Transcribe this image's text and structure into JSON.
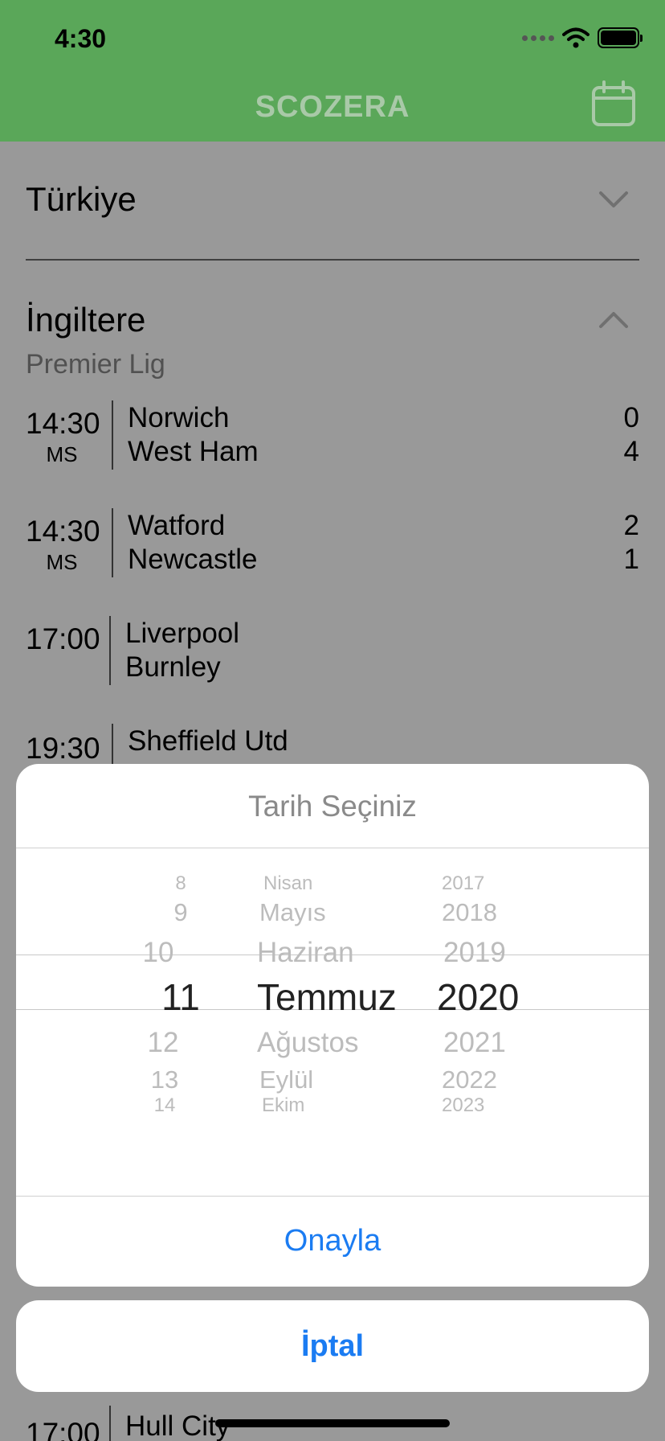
{
  "status_bar": {
    "time": "4:30"
  },
  "header": {
    "title": "SCOZERA"
  },
  "countries": [
    {
      "name": "Türkiye"
    },
    {
      "name": "İngiltere",
      "league": "Premier Lig"
    }
  ],
  "matches": [
    {
      "time": "14:30",
      "status": "MS",
      "home": "Norwich",
      "away": "West Ham",
      "home_score": "0",
      "away_score": "4"
    },
    {
      "time": "14:30",
      "status": "MS",
      "home": "Watford",
      "away": "Newcastle",
      "home_score": "2",
      "away_score": "1"
    },
    {
      "time": "17:00",
      "status": "",
      "home": "Liverpool",
      "away": "Burnley",
      "home_score": "",
      "away_score": ""
    },
    {
      "time": "19:30",
      "status": "",
      "home": "Sheffield Utd",
      "away": "",
      "home_score": "",
      "away_score": ""
    }
  ],
  "bottom_match": {
    "time": "17:00",
    "home": "Hull City"
  },
  "date_picker": {
    "title": "Tarih Seçiniz",
    "days": [
      "8",
      "9",
      "10",
      "11",
      "12",
      "13",
      "14"
    ],
    "months": [
      "Nisan",
      "Mayıs",
      "Haziran",
      "Temmuz",
      "Ağustos",
      "Eylül",
      "Ekim"
    ],
    "years": [
      "2017",
      "2018",
      "2019",
      "2020",
      "2021",
      "2022",
      "2023"
    ],
    "selected": {
      "day": "11",
      "month": "Temmuz",
      "year": "2020"
    },
    "confirm_label": "Onayla",
    "cancel_label": "İptal"
  },
  "colors": {
    "header_bg": "#5aa759",
    "action_blue": "#1b7cf2"
  }
}
